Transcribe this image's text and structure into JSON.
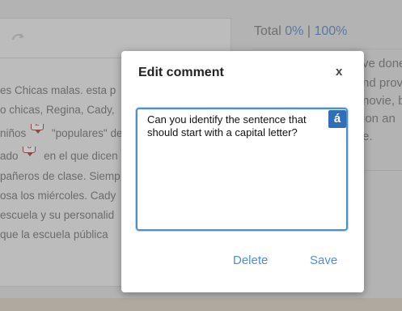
{
  "essay": {
    "lines": [
      {
        "text": "es Chicas malas. esta p",
        "markers": []
      },
      {
        "text": "o chicas, Regina, Cady,",
        "markers": []
      },
      {
        "text": "niños",
        "marker": "2",
        "after": "\"populares\" de"
      },
      {
        "text": "ado",
        "marker": "3",
        "after": "en el que dicen"
      },
      {
        "text": "pañeros de clase. Siemp",
        "markers": []
      },
      {
        "text": "osa los miércoles. Cady",
        "markers": []
      },
      {
        "text": "escuela y su personalid",
        "markers": []
      },
      {
        "text": "que la escuela pública",
        "markers": []
      }
    ]
  },
  "sidebar": {
    "total_label": "Total",
    "pct_a": "0%",
    "separator": "|",
    "pct_b": "100%",
    "fragments": [
      "ve done",
      "nd prov",
      "novie, b",
      "ion an",
      "e."
    ]
  },
  "modal": {
    "title": "Edit comment",
    "close_label": "x",
    "comment_text": "Can you identify the sentence that should start with a capital letter?",
    "accent_label": "á",
    "delete_label": "Delete",
    "save_label": "Save"
  }
}
